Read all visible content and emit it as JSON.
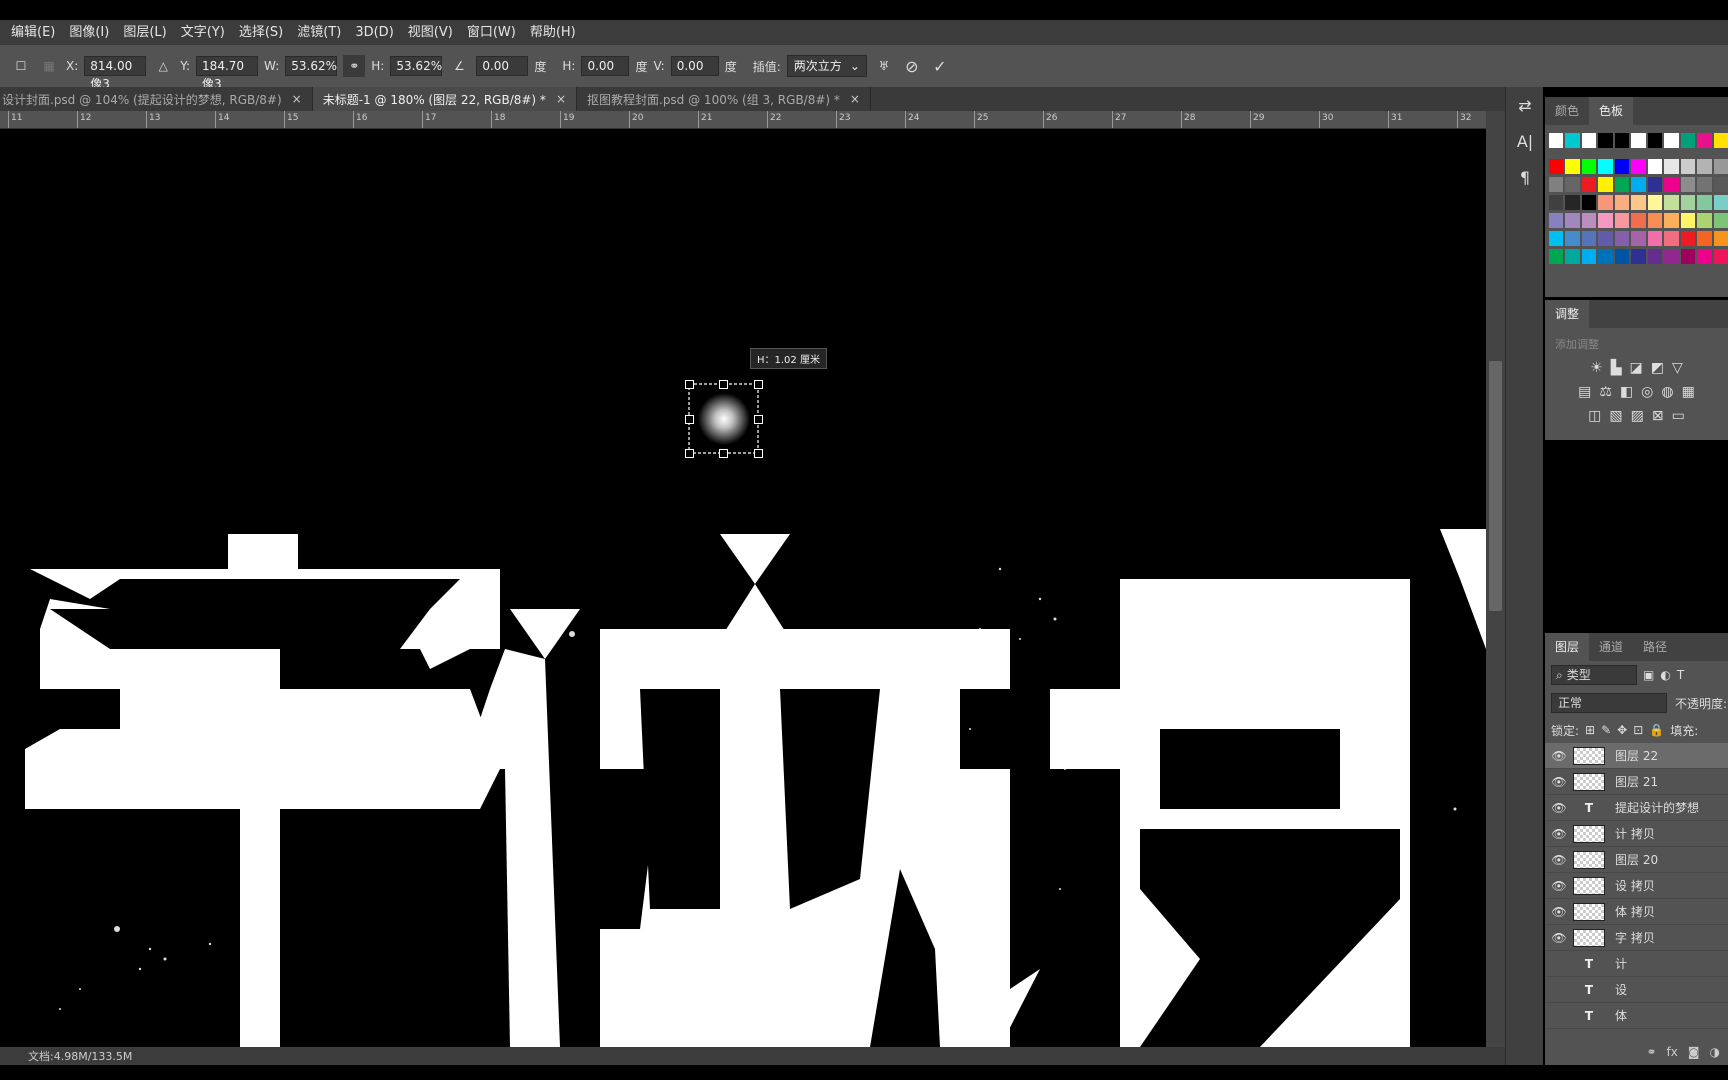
{
  "menu": [
    "编辑(E)",
    "图像(I)",
    "图层(L)",
    "文字(Y)",
    "选择(S)",
    "滤镜(T)",
    "3D(D)",
    "视图(V)",
    "窗口(W)",
    "帮助(H)"
  ],
  "options": {
    "x_label": "X:",
    "x_value": "814.00 像3",
    "y_label": "Y:",
    "y_value": "184.70 像3",
    "w_label": "W:",
    "w_value": "53.62%",
    "h_label": "H:",
    "h_value": "53.62%",
    "angle_value": "0.00",
    "angle_unit": "度",
    "skew_h_label": "H:",
    "skew_h_value": "0.00",
    "skew_h_unit": "度",
    "skew_v_label": "V:",
    "skew_v_value": "0.00",
    "skew_v_unit": "度",
    "interp_label": "插值:",
    "interp_value": "两次立方"
  },
  "tabs": [
    {
      "label": "设计封面.psd @ 104% (提起设计的梦想, RGB/8#)",
      "close": "×"
    },
    {
      "label": "未标题-1 @ 180% (图层 22, RGB/8#) *",
      "close": "×"
    },
    {
      "label": "抠图教程封面.psd @ 100% (组 3, RGB/8#) *",
      "close": "×"
    }
  ],
  "ruler_labels": [
    "11",
    "12",
    "13",
    "14",
    "15",
    "16",
    "17",
    "18",
    "19",
    "20",
    "21",
    "22",
    "23",
    "24",
    "25",
    "26",
    "27",
    "28",
    "29",
    "30",
    "31",
    "32"
  ],
  "tooltip": "H：1.02 厘米",
  "status": "文档:4.98M/133.5M",
  "swatch_panel": {
    "tabs": [
      "颜色",
      "色板"
    ],
    "rows": [
      [
        "#ffffff",
        "#00c8d0",
        "#ffffff",
        "#000000",
        "#000000",
        "#ffffff",
        "#000000",
        "#ffffff",
        "#00a07a",
        "#e8108c",
        "#ffe000"
      ],
      [
        "#ff0000",
        "#ffff00",
        "#00ff00",
        "#00ffff",
        "#0000ff",
        "#ff00ff",
        "#ffffff",
        "#e6e6e6",
        "#cccccc",
        "#b3b3b3",
        "#999999"
      ],
      [
        "#808080",
        "#666666",
        "#ed1c24",
        "#fff200",
        "#00a651",
        "#00aeef",
        "#2e3192",
        "#ec008c",
        "#8c8c8c",
        "#737373",
        "#595959"
      ],
      [
        "#404040",
        "#262626",
        "#000000",
        "#f7977a",
        "#f9ad81",
        "#fdc68a",
        "#fff79a",
        "#c4df9b",
        "#a3d39c",
        "#82ca9d",
        "#7bcdc8"
      ],
      [
        "#8781bd",
        "#a187be",
        "#bc8dbf",
        "#f49ac2",
        "#f6989d",
        "#f26c4f",
        "#f68e55",
        "#fbaf5c",
        "#fff467",
        "#acd372",
        "#7cc576"
      ],
      [
        "#00bff3",
        "#448ccb",
        "#5674b9",
        "#605ca8",
        "#855fa8",
        "#a763a8",
        "#f06eaa",
        "#f26d7d",
        "#ed1c24",
        "#f26522",
        "#f7941d"
      ],
      [
        "#00a651",
        "#00a99d",
        "#00aeef",
        "#0072bc",
        "#0054a6",
        "#2e3192",
        "#662d91",
        "#92278f",
        "#9e005d",
        "#ec008c",
        "#ed145b"
      ]
    ]
  },
  "adjust_panel": {
    "title": "调整",
    "hint": "添加调整"
  },
  "layers_panel": {
    "tabs": [
      "图层",
      "通道",
      "路径"
    ],
    "kind": "类型",
    "blend": "正常",
    "opacity_label": "不透明度:",
    "lock_label": "锁定:",
    "fill_label": "填充:",
    "layers": [
      {
        "name": "图层 22",
        "type": "raster",
        "visible": true,
        "selected": true
      },
      {
        "name": "图层 21",
        "type": "raster",
        "visible": true,
        "selected": false
      },
      {
        "name": "提起设计的梦想",
        "type": "text",
        "visible": true,
        "selected": false
      },
      {
        "name": "计 拷贝",
        "type": "raster",
        "visible": true,
        "selected": false
      },
      {
        "name": "图层 20",
        "type": "raster",
        "visible": true,
        "selected": false
      },
      {
        "name": "设 拷贝",
        "type": "raster",
        "visible": true,
        "selected": false
      },
      {
        "name": "体 拷贝",
        "type": "raster",
        "visible": true,
        "selected": false
      },
      {
        "name": "字 拷贝",
        "type": "raster",
        "visible": true,
        "selected": false
      },
      {
        "name": "计",
        "type": "text",
        "visible": false,
        "selected": false
      },
      {
        "name": "设",
        "type": "text",
        "visible": false,
        "selected": false
      },
      {
        "name": "体",
        "type": "text",
        "visible": false,
        "selected": false
      }
    ]
  }
}
